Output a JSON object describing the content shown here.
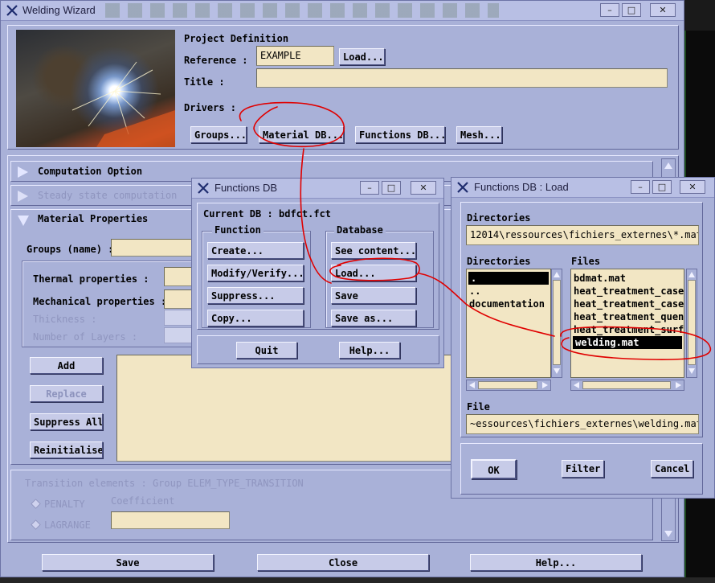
{
  "colors": {
    "panel": "#a9b1d8",
    "field": "#f2e6c4",
    "button": "#c7cbe8",
    "annotation": "#e00000"
  },
  "welding_wizard": {
    "title": "Welding Wizard",
    "project_definition_label": "Project Definition",
    "reference_label": "Reference :",
    "reference_value": "EXAMPLE",
    "load_label": "Load...",
    "title_label": "Title :",
    "title_value": "",
    "drivers_label": "Drivers :",
    "drivers": [
      "Groups...",
      "Material DB...",
      "Functions DB...",
      "Mesh..."
    ],
    "computation_option": "Computation Option",
    "steady_state": "Steady state computation",
    "material_properties": "Material Properties",
    "groups_name_label": "Groups (name) :",
    "thermal_label": "Thermal properties :",
    "mechanical_label": "Mechanical properties :",
    "thickness_label": "Thickness :",
    "layers_label": "Number of Layers :",
    "add_label": "Add",
    "replace_label": "Replace",
    "suppress_all_label": "Suppress All",
    "reinitialise_label": "Reinitialise",
    "transition_label": "Transition elements : Group ELEM_TYPE_TRANSITION",
    "coefficient_label": "Coefficient",
    "penalty_label": "PENALTY",
    "lagrange_label": "LAGRANGE",
    "save_label": "Save",
    "close_label": "Close",
    "help_label": "Help..."
  },
  "functions_db": {
    "title": "Functions DB",
    "current_db_label": "Current DB :",
    "current_db_value": "bdfct.fct",
    "function_group": "Function",
    "database_group": "Database",
    "function_buttons": [
      "Create...",
      "Modify/Verify...",
      "Suppress...",
      "Copy..."
    ],
    "database_buttons": [
      "See content...",
      "Load...",
      "Save",
      "Save as..."
    ],
    "quit_label": "Quit",
    "help_label": "Help..."
  },
  "functions_db_load": {
    "title": "Functions DB : Load",
    "filter_label": "Directories",
    "filter_value": "12014\\ressources\\fichiers_externes\\*.mat",
    "directories_label": "Directories",
    "files_label": "Files",
    "directories": [
      ".",
      "..",
      "documentation"
    ],
    "files": [
      "bdmat.mat",
      "heat_treatment_case",
      "heat_treatment_case",
      "heat_treatment_quen",
      "heat_treatment_surf",
      "welding.mat"
    ],
    "selected_directory": 0,
    "selected_file": 5,
    "file_label": "File",
    "file_value": "~essources\\fichiers_externes\\welding.mat",
    "ok_label": "OK",
    "filter_button_label": "Filter",
    "cancel_label": "Cancel"
  }
}
